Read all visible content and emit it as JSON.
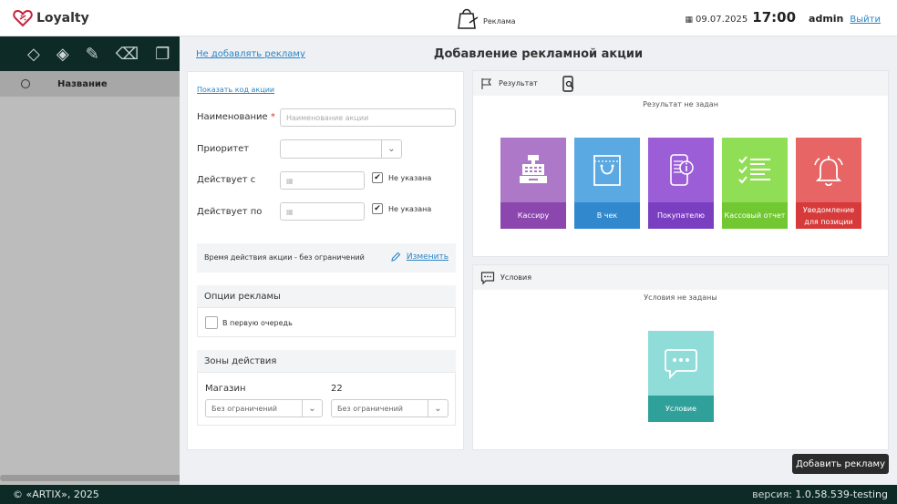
{
  "app": {
    "name": "Loyalty",
    "section": "Реклама",
    "date": "09.07.2025",
    "time": "17:00",
    "user": "admin",
    "logout": "Выйти"
  },
  "list": {
    "column_name": "Название"
  },
  "panel": {
    "no_ads_link": "Не добавлять рекламу",
    "title": "Добавление рекламной акции",
    "add_button": "Добавить рекламу"
  },
  "form": {
    "show_code": "Показать код акции",
    "name_label": "Наименование",
    "required_mark": "*",
    "name_placeholder": "Наименование акции",
    "priority_label": "Приоритет",
    "from_label": "Действует с",
    "to_label": "Действует по",
    "not_specified": "Не указана",
    "time_text": "Время действия акции - без ограничений",
    "change_link": "Изменить",
    "ad_options_title": "Опции рекламы",
    "first_queue": "В первую очередь",
    "zones_title": "Зоны действия",
    "store_label": "Магазин",
    "zone_number": "22",
    "no_limit": "Без ограничений"
  },
  "result": {
    "header": "Результат",
    "empty": "Результат не задан",
    "tiles": [
      {
        "label": "Кассиру",
        "top_color": "#ad78c8",
        "bottom_color": "#8b47ae"
      },
      {
        "label": "В чек",
        "top_color": "#5ba9e2",
        "bottom_color": "#3288cc"
      },
      {
        "label": "Покупателю",
        "top_color": "#9c5ed6",
        "bottom_color": "#7a3ec0"
      },
      {
        "label": "Кассовый отчет",
        "top_color": "#90de55",
        "bottom_color": "#71c832"
      },
      {
        "label": "Уведомление для позиции",
        "top_color": "#e76565",
        "bottom_color": "#d63a3a"
      }
    ]
  },
  "conditions": {
    "header": "Условия",
    "empty": "Условия не заданы",
    "tile": {
      "label": "Условие",
      "top_color": "#8fdcd9",
      "bottom_color": "#2fa19a"
    }
  },
  "footer": {
    "copyright": "© «ARTIX», 2025",
    "version_label": "версия:",
    "version": "1.0.58.539-testing"
  },
  "colors": {
    "accent_link": "#2a85c7",
    "dark": "#0e2a27"
  }
}
